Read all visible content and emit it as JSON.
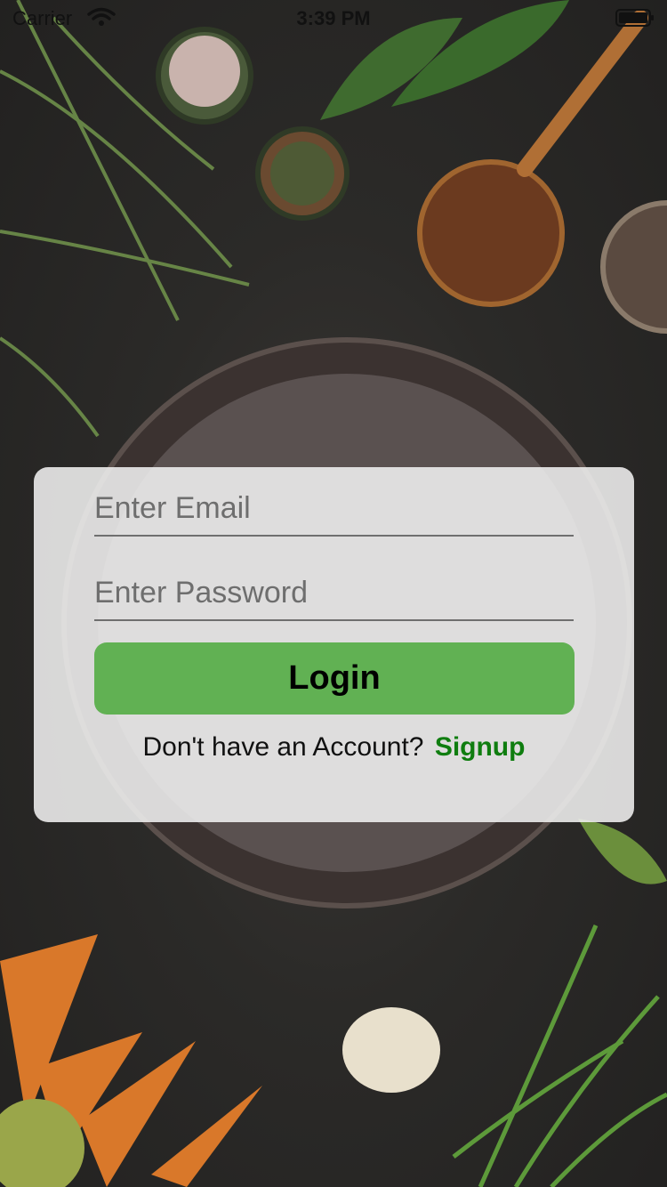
{
  "status_bar": {
    "carrier": "Carrier",
    "time": "3:39 PM"
  },
  "login_form": {
    "email_placeholder": "Enter Email",
    "password_placeholder": "Enter Password",
    "login_label": "Login",
    "signup_prompt": "Don't have an Account?",
    "signup_label": "Signup"
  },
  "colors": {
    "login_button": "#61b153",
    "signup_link": "#0f7d0f"
  }
}
